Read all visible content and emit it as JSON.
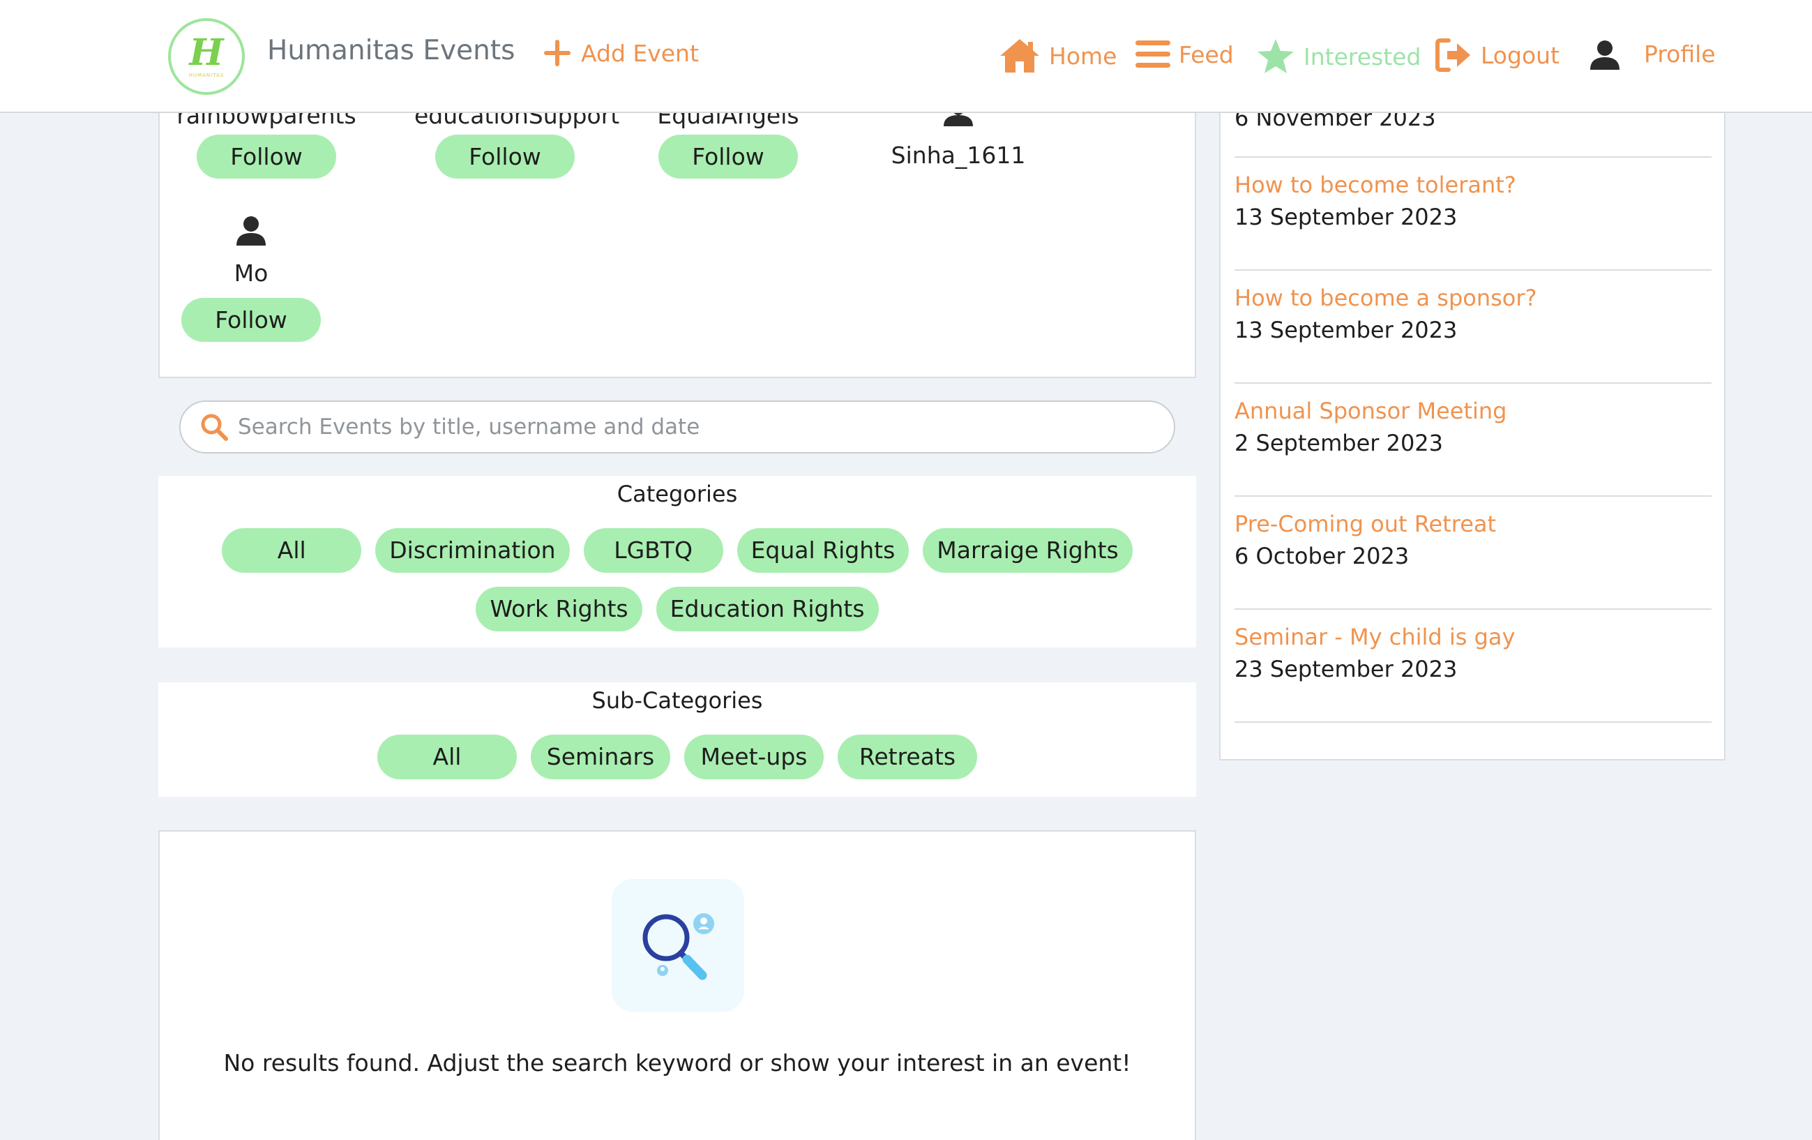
{
  "header": {
    "brand": "Humanitas Events",
    "logo_letter": "H",
    "logo_caption": "HUMANITAS",
    "add_event": "Add Event",
    "nav": {
      "home": "Home",
      "feed": "Feed",
      "interested": "Interested",
      "logout": "Logout",
      "profile": "Profile"
    }
  },
  "users": {
    "follow_label": "Follow",
    "list": [
      {
        "name": "rainbowparents"
      },
      {
        "name": "educationSupport"
      },
      {
        "name": "EqualAngels"
      },
      {
        "name": "Sinha_1611"
      },
      {
        "name": "Mo"
      }
    ]
  },
  "search": {
    "placeholder": "Search Events by title, username and date"
  },
  "categories": {
    "title": "Categories",
    "items": [
      "All",
      "Discrimination",
      "LGBTQ",
      "Equal Rights",
      "Marraige Rights",
      "Work Rights",
      "Education Rights"
    ]
  },
  "subcategories": {
    "title": "Sub-Categories",
    "items": [
      "All",
      "Seminars",
      "Meet-ups",
      "Retreats"
    ]
  },
  "results": {
    "empty_message": "No results found. Adjust the search keyword or show your interest in an event!"
  },
  "sidebar": {
    "events": [
      {
        "title": "",
        "date": "6 November 2023"
      },
      {
        "title": "How to become tolerant?",
        "date": "13 September 2023"
      },
      {
        "title": "How to become a sponsor?",
        "date": "13 September 2023"
      },
      {
        "title": "Annual Sponsor Meeting",
        "date": "2 September 2023"
      },
      {
        "title": "Pre-Coming out Retreat",
        "date": "6 October 2023"
      },
      {
        "title": "Seminar - My child is gay",
        "date": "23 September 2023"
      }
    ]
  },
  "colors": {
    "accent": "#f0934e",
    "pill": "#a8eeb0",
    "interested": "#9de3a8",
    "background": "#eff3f7"
  },
  "icons": [
    "plus-icon",
    "home-icon",
    "menu-icon",
    "star-icon",
    "logout-icon",
    "user-icon",
    "search-icon",
    "magnifier-illustration"
  ]
}
